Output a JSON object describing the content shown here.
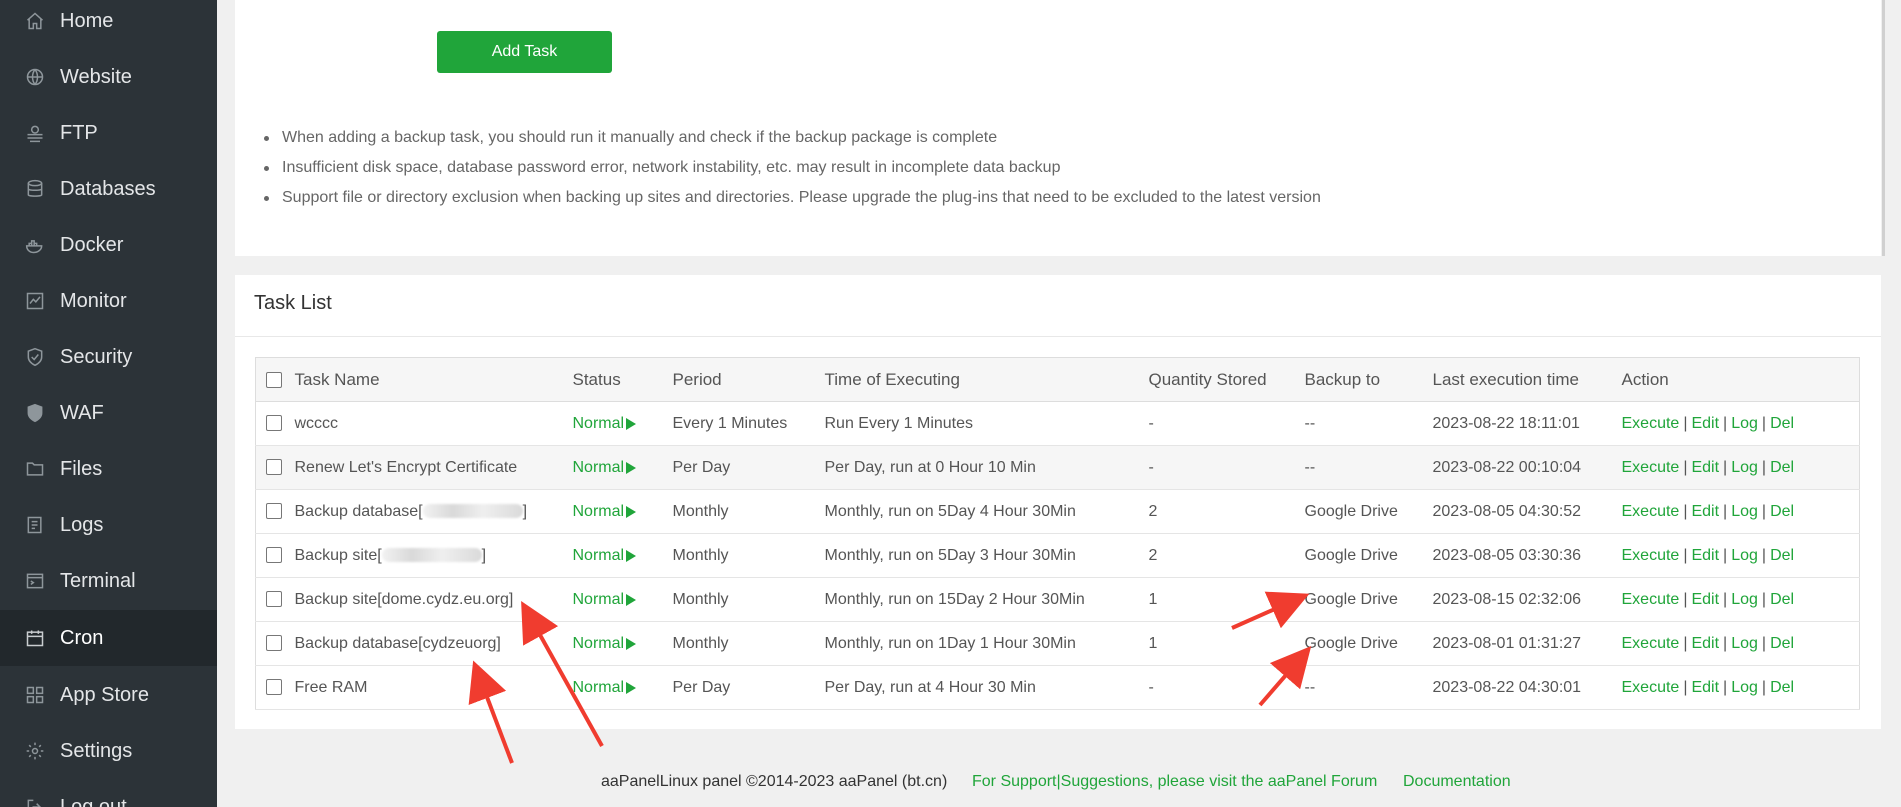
{
  "sidebar": {
    "items": [
      {
        "label": "Home",
        "icon": "home-icon"
      },
      {
        "label": "Website",
        "icon": "globe-icon"
      },
      {
        "label": "FTP",
        "icon": "ftp-icon"
      },
      {
        "label": "Databases",
        "icon": "database-icon"
      },
      {
        "label": "Docker",
        "icon": "docker-icon"
      },
      {
        "label": "Monitor",
        "icon": "monitor-icon"
      },
      {
        "label": "Security",
        "icon": "shield-icon"
      },
      {
        "label": "WAF",
        "icon": "waf-shield-icon"
      },
      {
        "label": "Files",
        "icon": "folder-icon"
      },
      {
        "label": "Logs",
        "icon": "logs-icon"
      },
      {
        "label": "Terminal",
        "icon": "terminal-icon"
      },
      {
        "label": "Cron",
        "icon": "cron-icon",
        "active": true
      },
      {
        "label": "App Store",
        "icon": "app-store-icon"
      },
      {
        "label": "Settings",
        "icon": "gear-icon"
      },
      {
        "label": "Log out",
        "icon": "logout-icon"
      }
    ]
  },
  "top_panel": {
    "add_task_label": "Add Task",
    "tips": [
      "When adding a backup task, you should run it manually and check if the backup package is complete",
      "Insufficient disk space, database password error, network instability, etc. may result in incomplete data backup",
      "Support file or directory exclusion when backing up sites and directories. Please upgrade the plug-ins that need to be excluded to the latest version"
    ]
  },
  "task_list": {
    "title": "Task List",
    "columns": [
      "Task Name",
      "Status",
      "Period",
      "Time of Executing",
      "Quantity Stored",
      "Backup to",
      "Last execution time",
      "Action"
    ],
    "rows": [
      {
        "name": "wcccc",
        "status": "Normal",
        "period": "Every 1 Minutes",
        "exec": "Run Every 1 Minutes",
        "stored": "-",
        "backup_to": "--",
        "last": "2023-08-22 18:11:01"
      },
      {
        "name": "Renew Let's Encrypt Certificate",
        "status": "Normal",
        "period": "Per Day",
        "exec": "Per Day, run at 0 Hour 10 Min",
        "stored": "-",
        "backup_to": "--",
        "last": "2023-08-22 00:10:04"
      },
      {
        "name_prefix": "Backup database[",
        "name_suffix": "]",
        "redacted": true,
        "status": "Normal",
        "period": "Monthly",
        "exec": "Monthly, run on 5Day 4 Hour 30Min",
        "stored": "2",
        "backup_to": "Google Drive",
        "last": "2023-08-05 04:30:52"
      },
      {
        "name_prefix": "Backup site[",
        "name_suffix": "]",
        "redacted": true,
        "status": "Normal",
        "period": "Monthly",
        "exec": "Monthly, run on 5Day 3 Hour 30Min",
        "stored": "2",
        "backup_to": "Google Drive",
        "last": "2023-08-05 03:30:36"
      },
      {
        "name": "Backup site[dome.cydz.eu.org]",
        "status": "Normal",
        "period": "Monthly",
        "exec": "Monthly, run on 15Day 2 Hour 30Min",
        "stored": "1",
        "backup_to": "Google Drive",
        "last": "2023-08-15 02:32:06"
      },
      {
        "name": "Backup database[cydzeuorg]",
        "status": "Normal",
        "period": "Monthly",
        "exec": "Monthly, run on 1Day 1 Hour 30Min",
        "stored": "1",
        "backup_to": "Google Drive",
        "last": "2023-08-01 01:31:27"
      },
      {
        "name": "Free RAM",
        "status": "Normal",
        "period": "Per Day",
        "exec": "Per Day, run at 4 Hour 30 Min",
        "stored": "-",
        "backup_to": "--",
        "last": "2023-08-22 04:30:01"
      }
    ],
    "actions": [
      "Execute",
      "Edit",
      "Log",
      "Del"
    ],
    "action_separator": "|"
  },
  "footer": {
    "copyright": "aaPanelLinux panel ©2014-2023 aaPanel (bt.cn)",
    "forum_link": "For Support|Suggestions, please visit the aaPanel Forum",
    "docs_link": "Documentation"
  },
  "colors": {
    "accent": "#20a53a",
    "sidebar_bg": "#2c3338",
    "sidebar_active": "#22282c",
    "annotation_arrow": "#f03c2f"
  }
}
